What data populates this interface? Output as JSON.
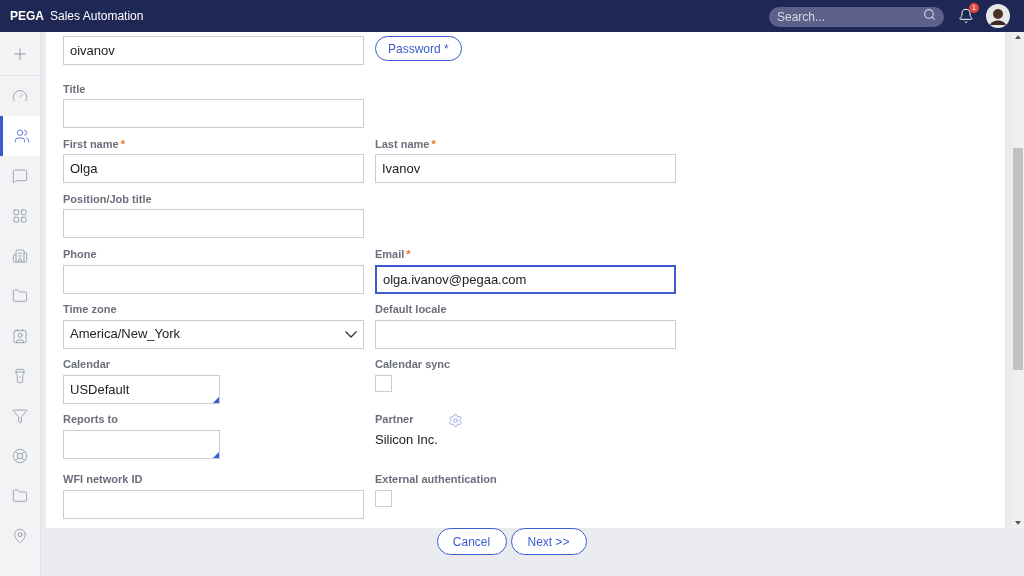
{
  "header": {
    "brand": "PEGA",
    "app": "Sales Automation",
    "search": {
      "placeholder": "Search..."
    },
    "notifications": "1"
  },
  "nav": [
    {
      "selected": false
    },
    {
      "selected": false
    },
    {
      "selected": true
    },
    {
      "selected": false
    },
    {
      "selected": false
    },
    {
      "selected": false
    },
    {
      "selected": false
    },
    {
      "selected": false
    },
    {
      "selected": false
    },
    {
      "selected": false
    },
    {
      "selected": false
    },
    {
      "selected": false
    },
    {
      "selected": false
    }
  ],
  "form": [
    {
      "left": {
        "kind": "text",
        "value": "oivanov"
      },
      "right": {
        "kind": "button",
        "value": "Password *"
      }
    },
    {
      "left": {
        "kind": "text",
        "label": "Title"
      }
    },
    {
      "left": {
        "kind": "text",
        "label": "First name",
        "required": "*",
        "value": "Olga"
      },
      "right": {
        "kind": "text",
        "label": "Last name",
        "required": "*",
        "value": "Ivanov"
      }
    },
    {
      "left": {
        "kind": "text",
        "label": "Position/Job title"
      }
    },
    {
      "left": {
        "kind": "text",
        "label": "Phone"
      },
      "right": {
        "kind": "text",
        "label": "Email",
        "required": "*",
        "value": "olga.ivanov@pegaa.com",
        "focused": true
      }
    },
    {
      "left": {
        "kind": "select",
        "label": "Time zone",
        "value": "America/New_York"
      },
      "right": {
        "kind": "text",
        "label": "Default locale"
      }
    },
    {
      "left": {
        "kind": "lookup",
        "label": "Calendar",
        "value": "USDefault"
      },
      "right": {
        "kind": "checkbox",
        "label": "Calendar sync",
        "checked": false
      }
    },
    {
      "left": {
        "kind": "lookup",
        "label": "Reports to"
      },
      "right": {
        "kind": "readonly",
        "label": "Partner",
        "value": "Silicon Inc."
      }
    },
    {
      "left": {
        "kind": "text",
        "label": "WFI network ID"
      },
      "right": {
        "kind": "checkbox",
        "label": "External authentication",
        "checked": false
      }
    }
  ],
  "buttons": [
    "Cancel",
    "Next >>"
  ]
}
